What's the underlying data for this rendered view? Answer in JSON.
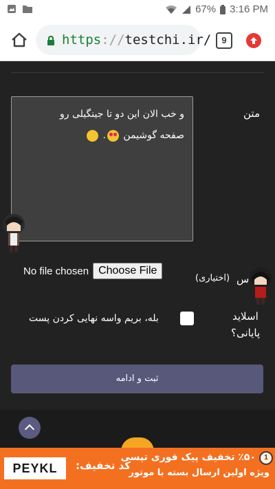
{
  "status_bar": {
    "battery": "67%",
    "time": "3:16 PM"
  },
  "browser": {
    "url_scheme": "https",
    "url_separator": "://",
    "url_host": "testchi.ir/",
    "tab_count": "9"
  },
  "form": {
    "text_label": "متن",
    "text_value_line1": "و خب الان این دو تا جینگیلی رو",
    "text_value_line2": "صفحه گوشیمن",
    "file_label_partial": "س",
    "file_label_optional": "(اختیاری)",
    "no_file_text": "No file chosen",
    "choose_file_label": "Choose File",
    "final_slide_label_line1": "اسلاید",
    "final_slide_label_line2": "پایانی؟",
    "checkbox_label": "بله، بریم واسه نهایی کردن پست",
    "checkbox_checked": false,
    "submit_label": "ثبت و ادامه"
  },
  "ad_banner": {
    "brand": "PEYKL",
    "discount_code_label": "کد تخفیف:",
    "headline": "٪۵۰ تخفیف پیک فوری تپسی",
    "subline": "ویژه اولین ارسال بسته با موتور",
    "badge": "1",
    "background_color": "#f37021"
  },
  "colors": {
    "page_background": "#222222",
    "submit_button": "#58587a",
    "url_scheme": "#188038"
  }
}
